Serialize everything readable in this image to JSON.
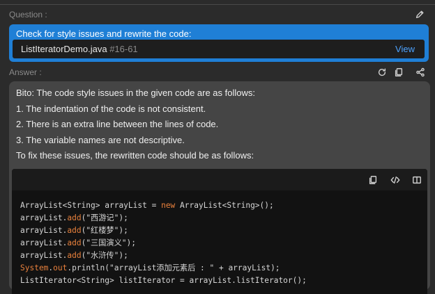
{
  "question": {
    "label": "Question :",
    "prompt": "Check for style issues and rewrite the code:",
    "file_name": "ListIteratorDemo.java",
    "file_lines": "#16-61",
    "view_label": "View"
  },
  "answer": {
    "label": "Answer :",
    "lines": [
      "Bito: The code style issues in the given code are as follows:",
      "1. The indentation of the code is not consistent.",
      "2. There is an extra line between the lines of code.",
      "3. The variable names are not descriptive.",
      " To fix these issues, the rewritten code should be as follows:"
    ]
  },
  "code": {
    "lines": [
      [
        {
          "t": "ArrayList<String> arrayList = ",
          "c": ""
        },
        {
          "t": "new",
          "c": "kw"
        },
        {
          "t": " ArrayList<String>();",
          "c": ""
        }
      ],
      [
        {
          "t": "arrayList.",
          "c": ""
        },
        {
          "t": "add",
          "c": "fn"
        },
        {
          "t": "(\"西游记\");",
          "c": ""
        }
      ],
      [
        {
          "t": "arrayList.",
          "c": ""
        },
        {
          "t": "add",
          "c": "fn"
        },
        {
          "t": "(\"红楼梦\");",
          "c": ""
        }
      ],
      [
        {
          "t": "arrayList.",
          "c": ""
        },
        {
          "t": "add",
          "c": "fn"
        },
        {
          "t": "(\"三国演义\");",
          "c": ""
        }
      ],
      [
        {
          "t": "arrayList.",
          "c": ""
        },
        {
          "t": "add",
          "c": "fn"
        },
        {
          "t": "(\"水浒传\");",
          "c": ""
        }
      ],
      [
        {
          "t": "System",
          "c": "kw"
        },
        {
          "t": ".",
          "c": ""
        },
        {
          "t": "out",
          "c": "kw"
        },
        {
          "t": ".println(\"arrayList添加元素后 : \" + arrayList);",
          "c": ""
        }
      ],
      [
        {
          "t": "ListIterator<String> listIterator = arrayList.listIterator();",
          "c": ""
        }
      ]
    ]
  },
  "icons": {
    "edit": "pencil-icon",
    "regenerate": "refresh-icon",
    "copy": "copy-icon",
    "share": "share-icon",
    "code_copy": "copy-icon",
    "code_insert": "code-icon",
    "code_split": "split-view-icon"
  },
  "colors": {
    "accent": "#1f7fd6",
    "link": "#4da3ff",
    "keyword": "#e8803c"
  }
}
